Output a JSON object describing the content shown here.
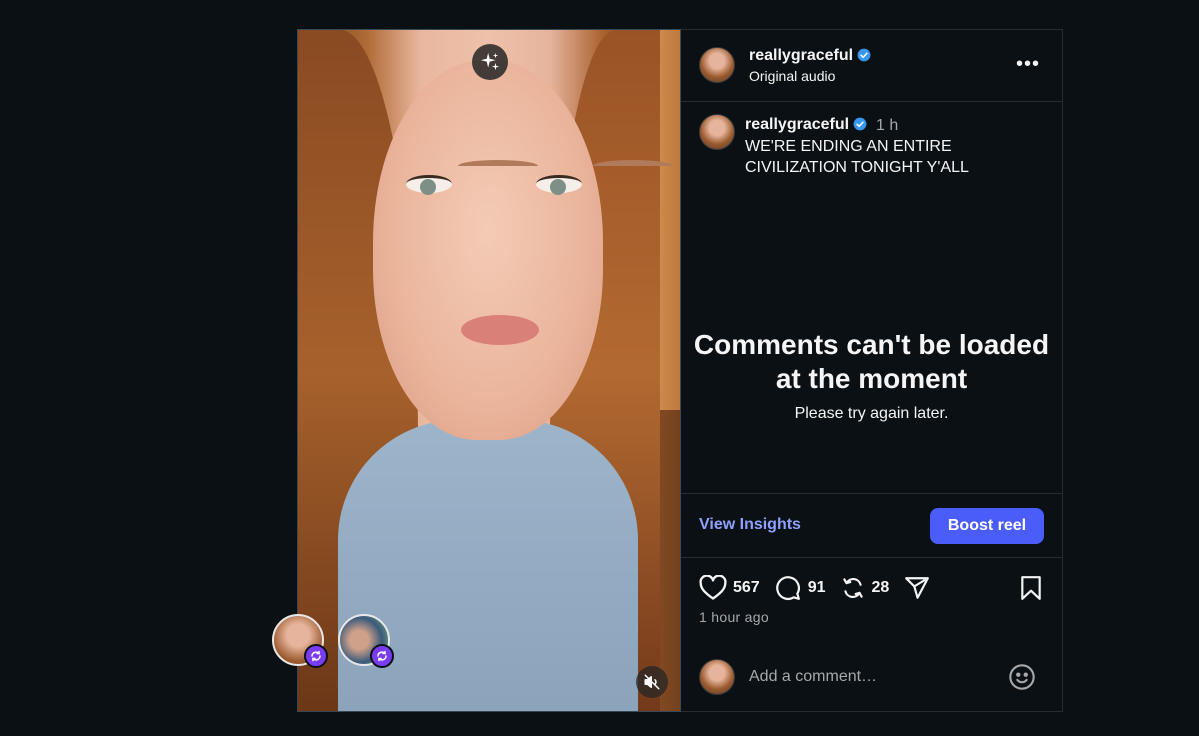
{
  "post": {
    "username": "reallygraceful",
    "audio": "Original audio",
    "caption_time": "1 h",
    "caption": "WE'RE ENDING AN ENTIRE CIVILIZATION TONIGHT Y'ALL"
  },
  "comments": {
    "error_title": "Comments can't be loaded at the moment",
    "error_sub": "Please try again later."
  },
  "insights": {
    "view_label": "View Insights",
    "boost_label": "Boost reel"
  },
  "stats": {
    "likes": "567",
    "comments": "91",
    "reposts": "28",
    "posted_ago": "1 hour ago"
  },
  "comment_box": {
    "placeholder": "Add a comment…"
  },
  "icons": {
    "sparkle": "sparkle-icon",
    "mute": "volume-muted-icon",
    "more": "more-options-icon",
    "verified": "verified-badge-icon",
    "heart": "heart-icon",
    "comment": "comment-icon",
    "repost": "repost-icon",
    "share": "send-icon",
    "save": "bookmark-icon",
    "emoji": "emoji-icon"
  },
  "colors": {
    "background": "#0b1014",
    "accent_link": "#8fa1ff",
    "boost_button": "#4a5df9",
    "verified": "#3897f0",
    "repost_badge": "#7a3cf2"
  }
}
